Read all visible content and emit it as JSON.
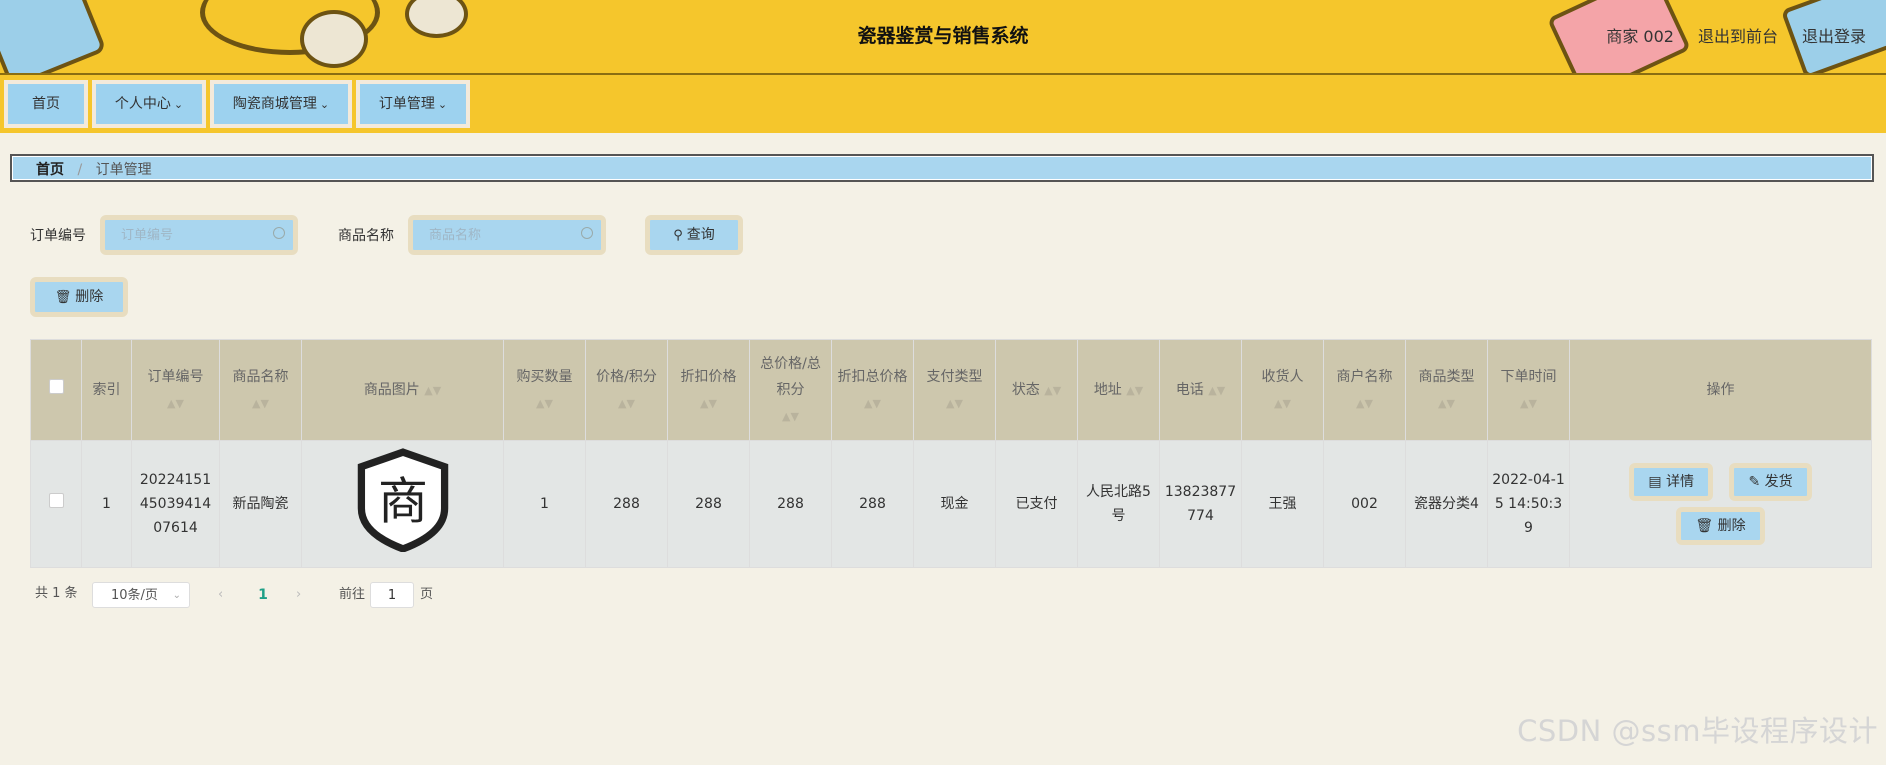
{
  "header": {
    "title": "瓷器鉴赏与销售系统",
    "user": "商家 002",
    "back_to_front": "退出到前台",
    "logout": "退出登录"
  },
  "nav": {
    "items": [
      {
        "label": "首页",
        "has_caret": false
      },
      {
        "label": "个人中心",
        "has_caret": true
      },
      {
        "label": "陶瓷商城管理",
        "has_caret": true
      },
      {
        "label": "订单管理",
        "has_caret": true
      }
    ]
  },
  "breadcrumb": {
    "home": "首页",
    "separator": "/",
    "current": "订单管理"
  },
  "search": {
    "order_no_label": "订单编号",
    "order_no_placeholder": "订单编号",
    "product_name_label": "商品名称",
    "product_name_placeholder": "商品名称",
    "query_button": "查询"
  },
  "toolbar": {
    "delete_button": "删除"
  },
  "table": {
    "headers": {
      "index": "索引",
      "order_no": "订单编号",
      "product_name": "商品名称",
      "product_image": "商品图片",
      "quantity": "购买数量",
      "price_points": "价格/积分",
      "discount_price": "折扣价格",
      "total_price_points": "总价格/总积分",
      "discount_total": "折扣总价格",
      "pay_type": "支付类型",
      "status": "状态",
      "address": "地址",
      "phone": "电话",
      "receiver": "收货人",
      "merchant_name": "商户名称",
      "product_type": "商品类型",
      "order_time": "下单时间",
      "actions": "操作"
    },
    "rows": [
      {
        "index": "1",
        "order_no": "2022415145039414 07614",
        "product_name": "新品陶瓷",
        "product_image_text": "商",
        "quantity": "1",
        "price_points": "288",
        "discount_price": "288",
        "total_price_points": "288",
        "discount_total": "288",
        "pay_type": "现金",
        "status": "已支付",
        "address": "人民北路5号",
        "phone": "13823877774",
        "receiver": "王强",
        "merchant_name": "002",
        "product_type": "瓷器分类4",
        "order_time": "2022-04-15 14:50:39",
        "actions": {
          "detail": "详情",
          "ship": "发货",
          "delete": "删除"
        }
      }
    ]
  },
  "pagination": {
    "total": "共 1 条",
    "page_size": "10条/页",
    "current_page": "1",
    "goto_label": "前往",
    "goto_value": "1",
    "page_unit": "页"
  },
  "watermark": "CSDN @ssm毕设程序设计",
  "colors": {
    "header_bg": "#f5c62c",
    "button_bg": "#a9d6ef",
    "table_header_bg": "#cdc7ad",
    "page_bg": "#f4f1e6"
  }
}
